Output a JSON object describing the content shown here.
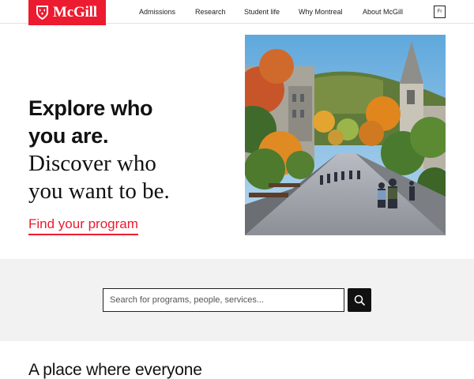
{
  "header": {
    "logo_text": "McGill",
    "nav": [
      "Admissions",
      "Research",
      "Student life",
      "Why Montreal",
      "About McGill"
    ],
    "lang_label": "Fr"
  },
  "hero": {
    "line1": "Explore who",
    "line2": "you are.",
    "line3": "Discover who",
    "line4": "you want to be.",
    "link": "Find your program"
  },
  "search": {
    "placeholder": "Search for programs, people, services..."
  },
  "section": {
    "heading": "A place where everyone"
  },
  "colors": {
    "brand_red": "#ed1b2f",
    "search_band_bg": "#f2f2f2"
  },
  "icons": {
    "logo": "mcgill-shield-icon",
    "search": "search-icon"
  }
}
